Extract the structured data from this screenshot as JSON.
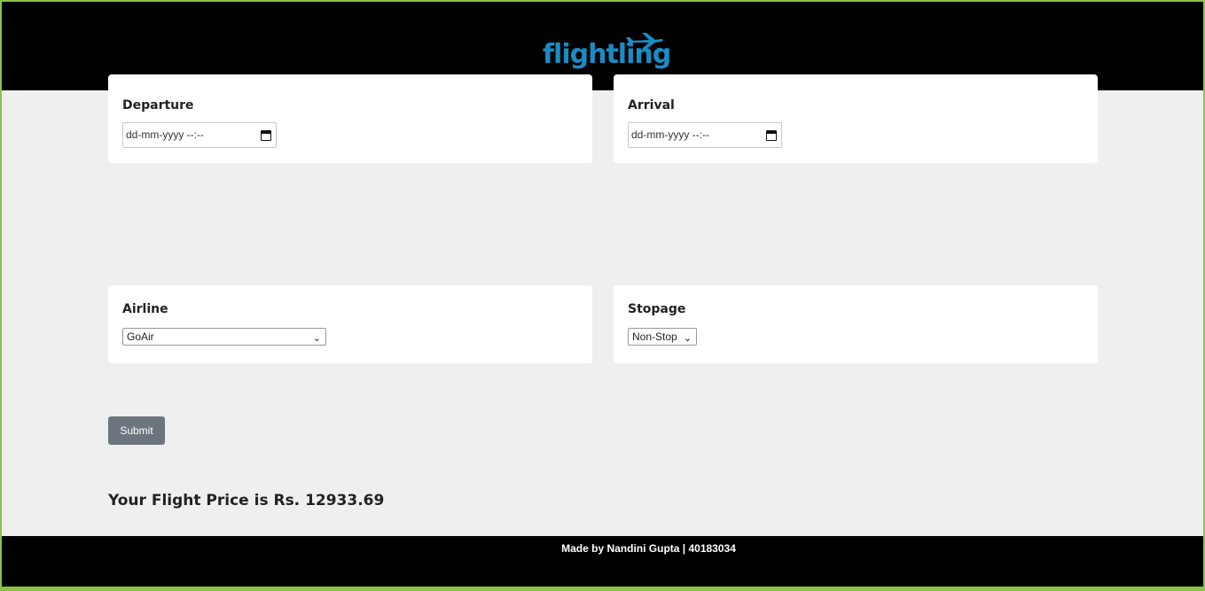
{
  "brand": {
    "logo_text": "flightling",
    "accent_color": "#1a8cc4"
  },
  "departure": {
    "label": "Departure",
    "placeholder": "dd-mm-yyyy --:--"
  },
  "arrival": {
    "label": "Arrival",
    "placeholder": "dd-mm-yyyy --:--"
  },
  "airline": {
    "label": "Airline",
    "selected": "GoAir"
  },
  "stopage": {
    "label": "Stopage",
    "selected": "Non-Stop"
  },
  "submit": {
    "label": "Submit"
  },
  "result": {
    "text": "Your Flight Price is Rs. 12933.69"
  },
  "footer": {
    "text": "Made by Nandini Gupta | 40183034"
  },
  "icons": {
    "calendar": "calendar-icon",
    "chevron": "chevron-down-icon",
    "plane": "plane-icon"
  }
}
